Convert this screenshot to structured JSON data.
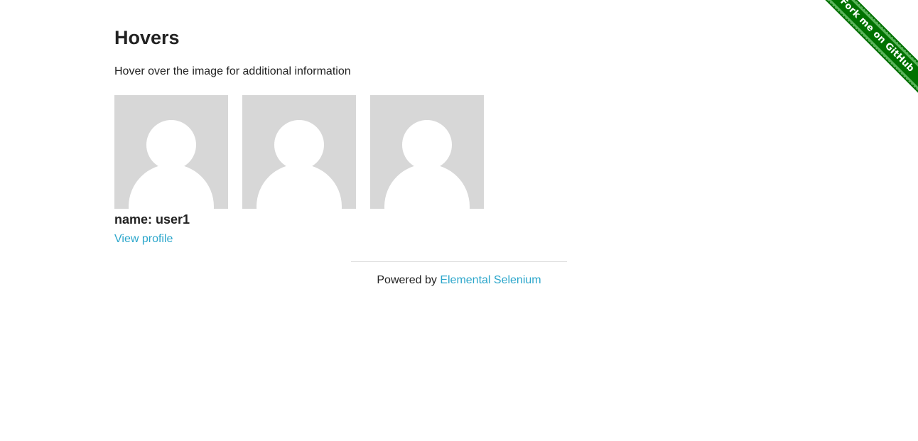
{
  "ribbon": {
    "label": "Fork me on GitHub",
    "color": "#007200"
  },
  "main": {
    "title": "Hovers",
    "subtitle": "Hover over the image for additional information"
  },
  "figures": [
    {
      "icon": "user-avatar-icon"
    },
    {
      "icon": "user-avatar-icon"
    },
    {
      "icon": "user-avatar-icon"
    }
  ],
  "hover_caption": {
    "name": "name: user1",
    "link": "View profile"
  },
  "footer": {
    "prefix": "Powered by ",
    "link": "Elemental Selenium"
  },
  "colors": {
    "link": "#2ba6cb",
    "avatar_bg": "#d7d7d7",
    "text": "#222222"
  }
}
